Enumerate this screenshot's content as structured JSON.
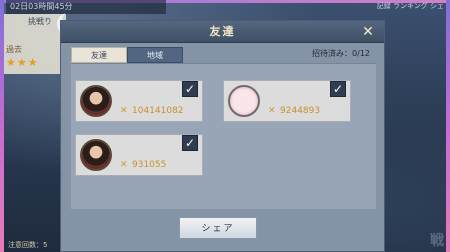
{
  "background": {
    "top_line": "02日03時間45分",
    "left_label": "挑戦り",
    "left_sub": "過去",
    "stars": "★★★",
    "top_right": "記録 ランキング シェ",
    "bottom_left": "注意回数：5",
    "bottom_right": "戦"
  },
  "dialog": {
    "title": "友達",
    "close_icon": "close-icon",
    "tabs": [
      {
        "label": "友達",
        "active": false
      },
      {
        "label": "地域",
        "active": true
      }
    ],
    "invite_count": "招待済み：0/12",
    "friends": [
      {
        "name": "",
        "id": "104141082",
        "avatar": "character-avatar",
        "checked": true
      },
      {
        "name": "",
        "id": "9244893",
        "avatar": "blank-avatar",
        "checked": true
      },
      {
        "name": "",
        "id": "931055",
        "avatar": "character-avatar",
        "checked": true
      }
    ],
    "share_label": "シェア"
  },
  "colors": {
    "accent_gold": "#c9912a",
    "header_bg": "#3e4f66",
    "frame_gradient": "#c86bd2"
  }
}
